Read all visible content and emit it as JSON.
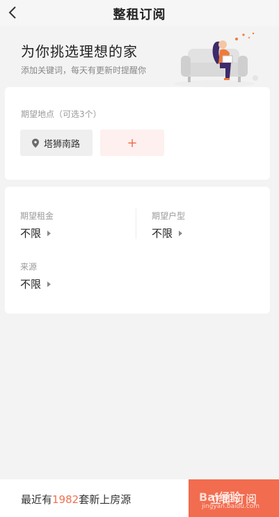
{
  "header": {
    "title": "整租订阅",
    "back_icon": "chevron-left-icon"
  },
  "hero": {
    "heading": "为你挑选理想的家",
    "subheading": "添加关键词，每天有更新时提醒你"
  },
  "location": {
    "label": "期望地点（可选3个）",
    "selected": [
      {
        "name": "塔狮南路",
        "icon": "map-pin-icon"
      }
    ],
    "add_label": "+"
  },
  "preferences": {
    "rent": {
      "label": "期望租金",
      "value": "不限"
    },
    "layout": {
      "label": "期望户型",
      "value": "不限"
    },
    "source": {
      "label": "来源",
      "value": "不限"
    }
  },
  "footer": {
    "prefix": "最近有",
    "count": "1982",
    "suffix": "套新上房源",
    "button_label": "立即订阅"
  },
  "watermark": {
    "text": "Bai经验",
    "url": "jingyan.baidu.com"
  },
  "colors": {
    "accent": "#f26c4f",
    "accent_light": "#fdf0ee",
    "background": "#f3f3f3"
  }
}
